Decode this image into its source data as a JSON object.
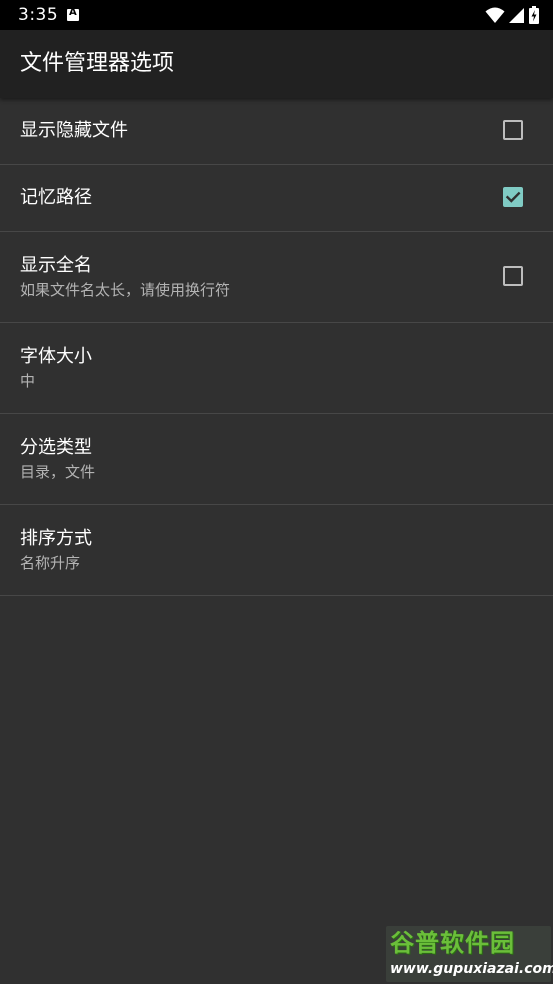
{
  "status_bar": {
    "time": "3:35",
    "icons": [
      "notification-a-icon",
      "wifi-icon",
      "signal-icon",
      "battery-charging-icon"
    ]
  },
  "app_bar": {
    "title": "文件管理器选项"
  },
  "preferences": [
    {
      "title": "显示隐藏文件",
      "summary": "",
      "checkbox": true,
      "checked": false
    },
    {
      "title": "记忆路径",
      "summary": "",
      "checkbox": true,
      "checked": true
    },
    {
      "title": "显示全名",
      "summary": "如果文件名太长，请使用换行符",
      "checkbox": true,
      "checked": false
    },
    {
      "title": "字体大小",
      "summary": "中",
      "checkbox": false
    },
    {
      "title": "分选类型",
      "summary": "目录，文件",
      "checkbox": false
    },
    {
      "title": "排序方式",
      "summary": "名称升序",
      "checkbox": false
    }
  ],
  "watermark": {
    "name": "谷普软件园",
    "url": "www.gupuxiazai.com"
  },
  "colors": {
    "background": "#303030",
    "app_bar": "#212121",
    "status_bar": "#000000",
    "accent": "#80cbc4",
    "divider": "#474747",
    "summary_text": "#b3b3b3"
  }
}
